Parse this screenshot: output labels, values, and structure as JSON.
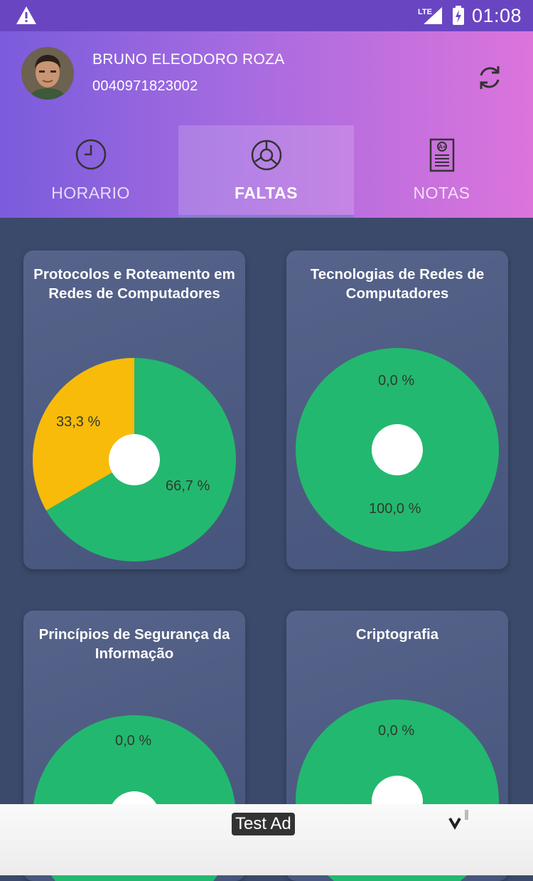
{
  "status": {
    "time": "01:08",
    "network": "LTE"
  },
  "user": {
    "name": "BRUNO ELEODORO ROZA",
    "id": "0040971823002"
  },
  "tabs": [
    {
      "label": "HORARIO",
      "icon": "clock-icon",
      "active": false
    },
    {
      "label": "FALTAS",
      "icon": "pie-chart-icon",
      "active": true
    },
    {
      "label": "NOTAS",
      "icon": "grade-report-icon",
      "active": false
    }
  ],
  "colors": {
    "present": "#23b86f",
    "absent": "#f8bb0a",
    "accent": "#7a5cdc"
  },
  "cards": [
    {
      "title": "Protocolos e Roteamento em Redes de Computadores",
      "present_pct": 66.7,
      "absent_pct": 33.3,
      "present_label": "66,7 %",
      "absent_label": "33,3 %"
    },
    {
      "title": "Tecnologias de Redes de Computadores",
      "present_pct": 100,
      "absent_pct": 0,
      "present_label": "100,0 %",
      "absent_label": "0,0 %"
    },
    {
      "title": "Princípios de Segurança da Informação",
      "present_pct": 100,
      "absent_pct": 0,
      "present_label": "",
      "absent_label": "0,0 %"
    },
    {
      "title": "Criptografia",
      "present_pct": 100,
      "absent_pct": 0,
      "present_label": "",
      "absent_label": "0,0 %"
    }
  ],
  "ad": {
    "label": "Test Ad"
  }
}
